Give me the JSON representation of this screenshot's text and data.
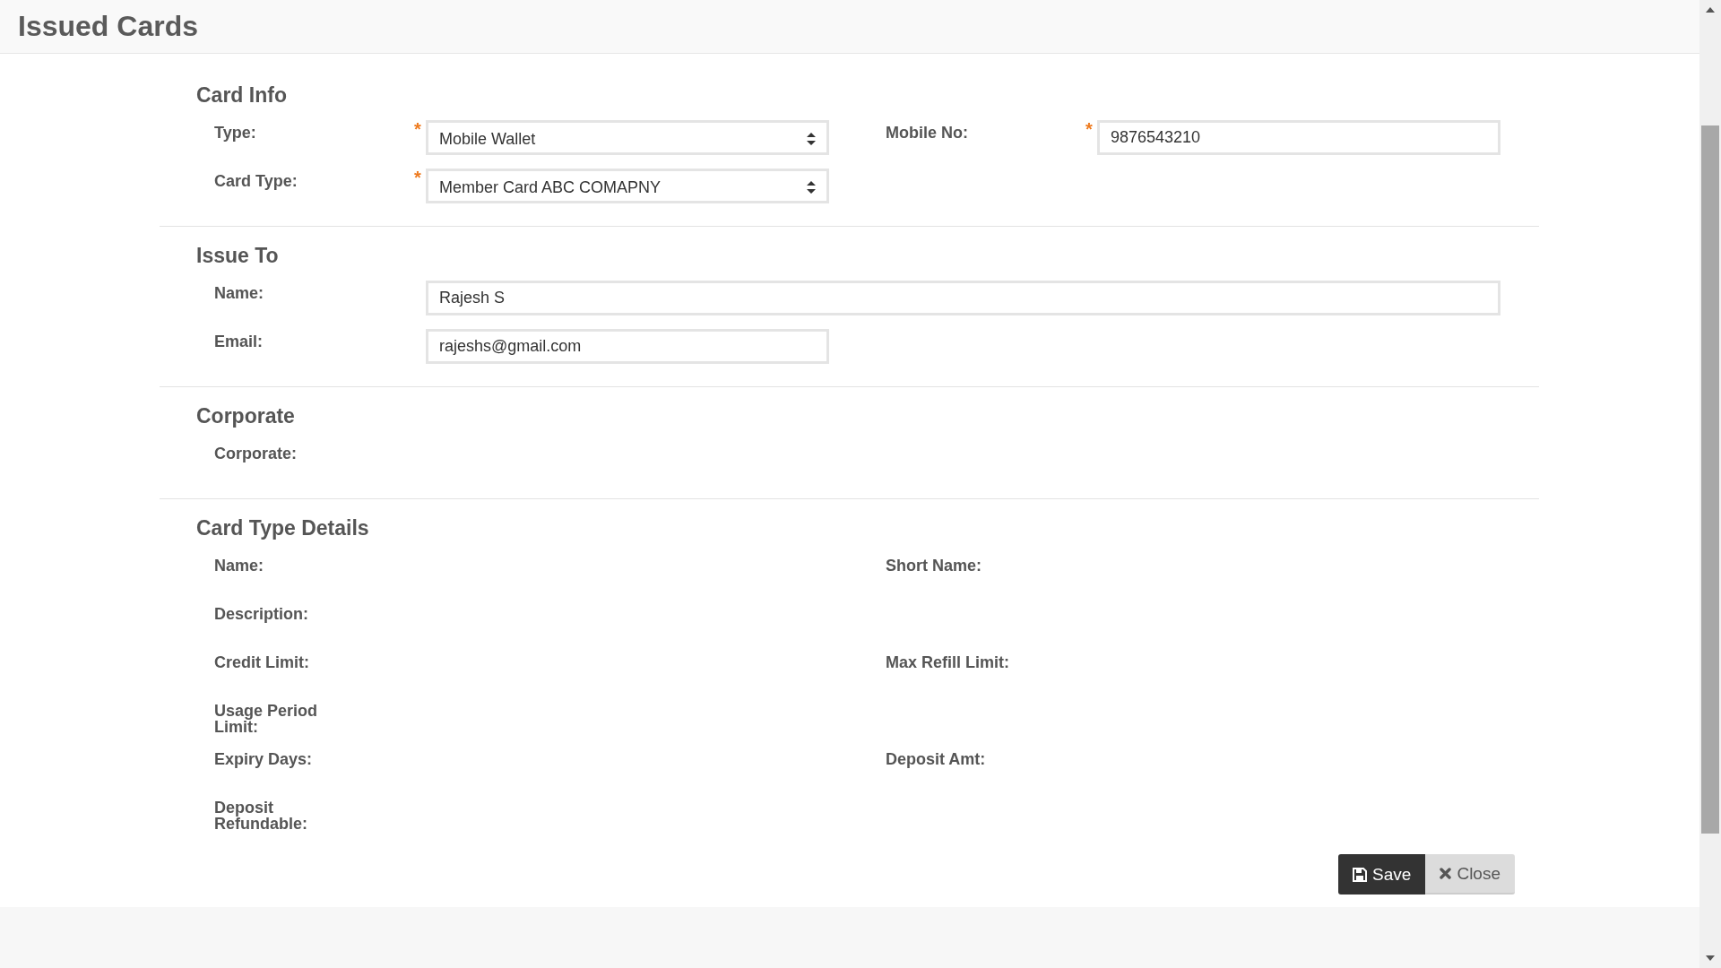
{
  "header": {
    "title": "Issued Cards"
  },
  "sections": [
    {
      "title": "Card Info",
      "rows": [
        {
          "cells": [
            {
              "label": "Type:",
              "kind": "select",
              "value": "Mobile Wallet",
              "required_mark": "*"
            },
            {
              "label": "Mobile No:",
              "kind": "input",
              "value": "9876543210",
              "required_mark": "*"
            }
          ]
        },
        {
          "cells": [
            {
              "label": "Card Type:",
              "kind": "select",
              "value": "Member Card ABC COMAPNY",
              "required_mark": "*"
            }
          ]
        }
      ]
    },
    {
      "title": "Issue To",
      "rows": [
        {
          "cells": [
            {
              "label": "Name:",
              "kind": "wide_input",
              "value": "Rajesh S"
            }
          ]
        },
        {
          "cells": [
            {
              "label": "Email:",
              "kind": "input",
              "value": "rajeshs@gmail.com"
            }
          ]
        }
      ]
    },
    {
      "title": "Corporate",
      "rows": [
        {
          "cells": [
            {
              "label": "Corporate:",
              "kind": "empty"
            }
          ]
        }
      ]
    },
    {
      "title": "Card Type Details",
      "rows": [
        {
          "cells": [
            {
              "label": "Name:",
              "kind": "empty"
            },
            {
              "label": "Short Name:",
              "kind": "empty"
            }
          ]
        },
        {
          "cells": [
            {
              "label": "Description:",
              "kind": "empty"
            }
          ]
        },
        {
          "cells": [
            {
              "label": "Credit Limit:",
              "kind": "empty"
            },
            {
              "label": "Max Refill Limit:",
              "kind": "empty"
            }
          ]
        },
        {
          "cells": [
            {
              "label": "Usage Period Limit:",
              "kind": "empty"
            }
          ]
        },
        {
          "cells": [
            {
              "label": "Expiry Days:",
              "kind": "empty"
            },
            {
              "label": "Deposit Amt:",
              "kind": "empty"
            }
          ]
        },
        {
          "cells": [
            {
              "label": "Deposit Refundable:",
              "kind": "empty"
            }
          ]
        }
      ]
    }
  ],
  "buttons": [
    {
      "kind": "save",
      "label": "Save"
    },
    {
      "kind": "close",
      "label": "Close"
    }
  ]
}
